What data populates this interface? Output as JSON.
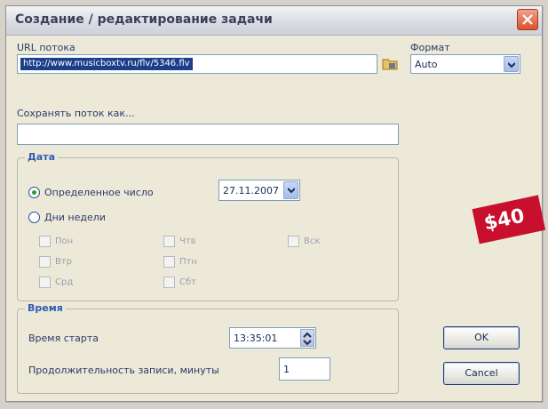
{
  "window": {
    "title": "Создание / редактирование задачи"
  },
  "url": {
    "label": "URL потока",
    "value": "http://www.musicboxtv.ru/flv/5346.flv"
  },
  "format": {
    "label": "Формат",
    "value": "Auto"
  },
  "save_as": {
    "label": "Сохранять поток как...",
    "value": ""
  },
  "date_group": {
    "legend": "Дата",
    "specific_date_label": "Определенное число",
    "date_value": "27.11.2007",
    "weekdays_label": "Дни недели",
    "days": [
      "Пон",
      "Втр",
      "Срд",
      "Чтв",
      "Птн",
      "Сбт",
      "Вск"
    ]
  },
  "time_group": {
    "legend": "Время",
    "start_label": "Время старта",
    "start_value": "13:35:01",
    "duration_label": "Продолжительность записи, минуты",
    "duration_value": "1"
  },
  "buttons": {
    "ok": "OK",
    "cancel": "Cancel"
  },
  "price_sticker": "$40",
  "colors": {
    "accent": "#1f4d9b",
    "close": "#d9532f",
    "sticker": "#c8102e"
  }
}
